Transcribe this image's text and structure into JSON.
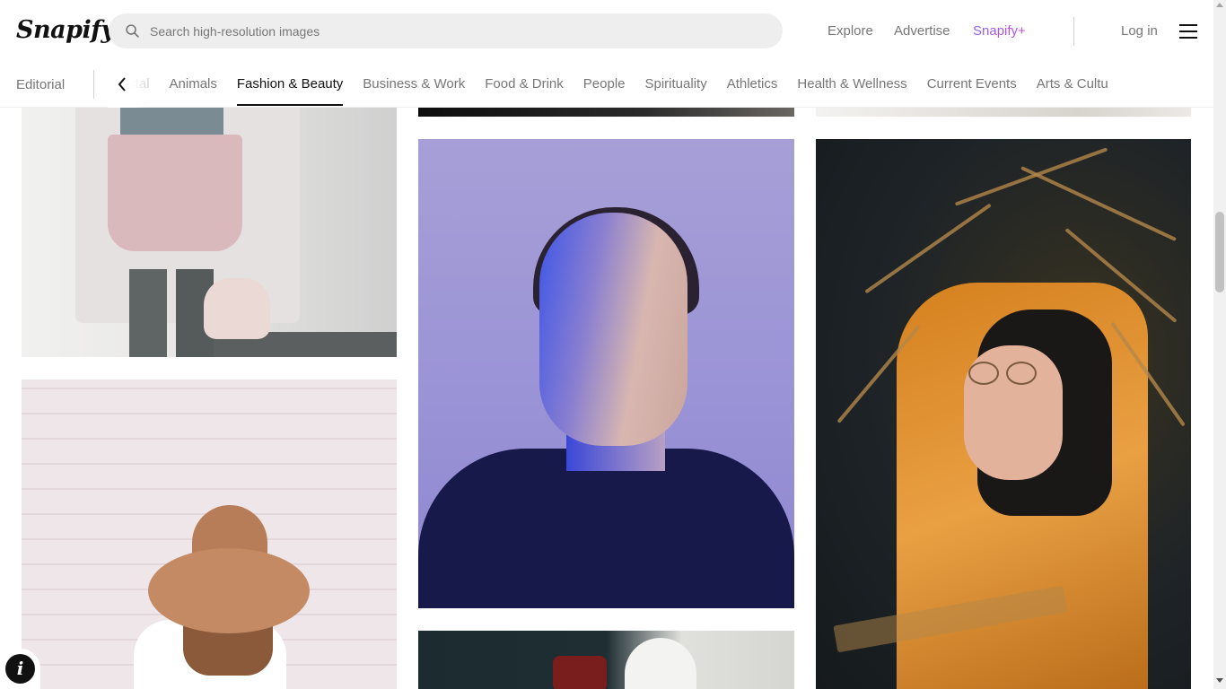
{
  "brand": {
    "name": "Snapify"
  },
  "search": {
    "placeholder": "Search high-resolution images",
    "value": ""
  },
  "nav": {
    "explore": "Explore",
    "advertise": "Advertise",
    "plus": "Snapify+",
    "login": "Log in"
  },
  "categories": {
    "editorial": "Editorial",
    "items": [
      {
        "label": "ental"
      },
      {
        "label": "Animals"
      },
      {
        "label": "Fashion & Beauty"
      },
      {
        "label": "Business & Work"
      },
      {
        "label": "Food & Drink"
      },
      {
        "label": "People"
      },
      {
        "label": "Spirituality"
      },
      {
        "label": "Athletics"
      },
      {
        "label": "Health & Wellness"
      },
      {
        "label": "Current Events"
      },
      {
        "label": "Arts & Cultu"
      }
    ],
    "active": "Fashion & Beauty"
  },
  "info_button": {
    "glyph": "i"
  },
  "colors": {
    "accent_plus_start": "#8d5cf6",
    "accent_plus_end": "#c24fd8",
    "progress": "#2a84e0"
  }
}
